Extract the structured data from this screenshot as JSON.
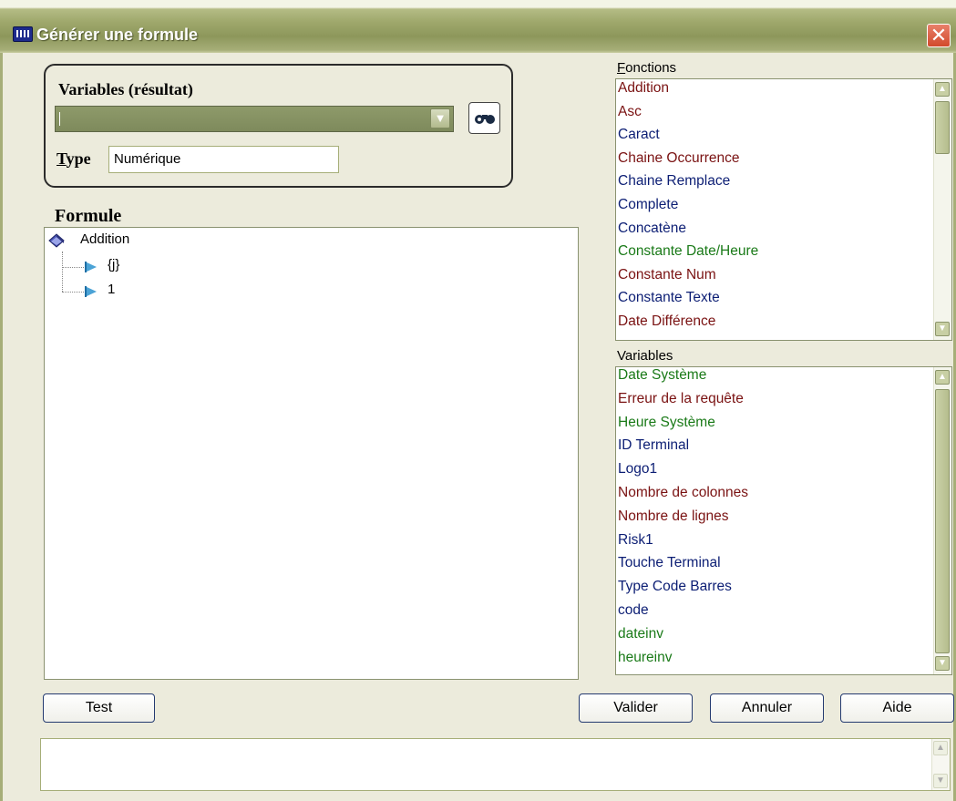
{
  "window": {
    "title": "Générer une formule",
    "close_label": "✕"
  },
  "variables_result": {
    "label": "Variables (résultat)",
    "selected": "",
    "type_label_first": "T",
    "type_label_rest": "ype",
    "type_value": "Numérique"
  },
  "formule": {
    "label": "Formule",
    "root": "Addition",
    "children": [
      "{j}",
      "1"
    ]
  },
  "fonctions": {
    "label_first": "F",
    "label_rest": "onctions",
    "items": [
      {
        "text": "Addition",
        "color": "#7a1212"
      },
      {
        "text": "Asc",
        "color": "#7a1212"
      },
      {
        "text": "Caract",
        "color": "#0c1e74"
      },
      {
        "text": "Chaine Occurrence",
        "color": "#7a1212"
      },
      {
        "text": "Chaine Remplace",
        "color": "#0c1e74"
      },
      {
        "text": "Complete",
        "color": "#0c1e74"
      },
      {
        "text": "Concatène",
        "color": "#0c1e74"
      },
      {
        "text": "Constante Date/Heure",
        "color": "#1a7a18"
      },
      {
        "text": "Constante Num",
        "color": "#7a1212"
      },
      {
        "text": "Constante Texte",
        "color": "#0c1e74"
      },
      {
        "text": "Date Différence",
        "color": "#7a1212"
      }
    ]
  },
  "variables": {
    "label": "Variables",
    "items": [
      {
        "text": "Date Système",
        "color": "#1a7a18"
      },
      {
        "text": "Erreur de la requête",
        "color": "#7a1212"
      },
      {
        "text": "Heure Système",
        "color": "#1a7a18"
      },
      {
        "text": "ID Terminal",
        "color": "#0c1e74"
      },
      {
        "text": "Logo1",
        "color": "#0c1e74"
      },
      {
        "text": "Nombre de colonnes",
        "color": "#7a1212"
      },
      {
        "text": "Nombre de lignes",
        "color": "#7a1212"
      },
      {
        "text": "Risk1",
        "color": "#0c1e74"
      },
      {
        "text": "Touche Terminal",
        "color": "#0c1e74"
      },
      {
        "text": "Type Code Barres",
        "color": "#0c1e74"
      },
      {
        "text": "code",
        "color": "#0c1e74"
      },
      {
        "text": "dateinv",
        "color": "#1a7a18"
      },
      {
        "text": "heureinv",
        "color": "#1a7a18"
      }
    ]
  },
  "buttons": {
    "test": "Test",
    "valider": "Valider",
    "annuler": "Annuler",
    "aide": "Aide"
  },
  "message": "",
  "icons": {
    "app": "app-window-icon",
    "search": "search-binoculars-icon",
    "dropdown": "chevron-down-icon",
    "function": "function-book-icon",
    "argument": "arrow-right-icon"
  }
}
